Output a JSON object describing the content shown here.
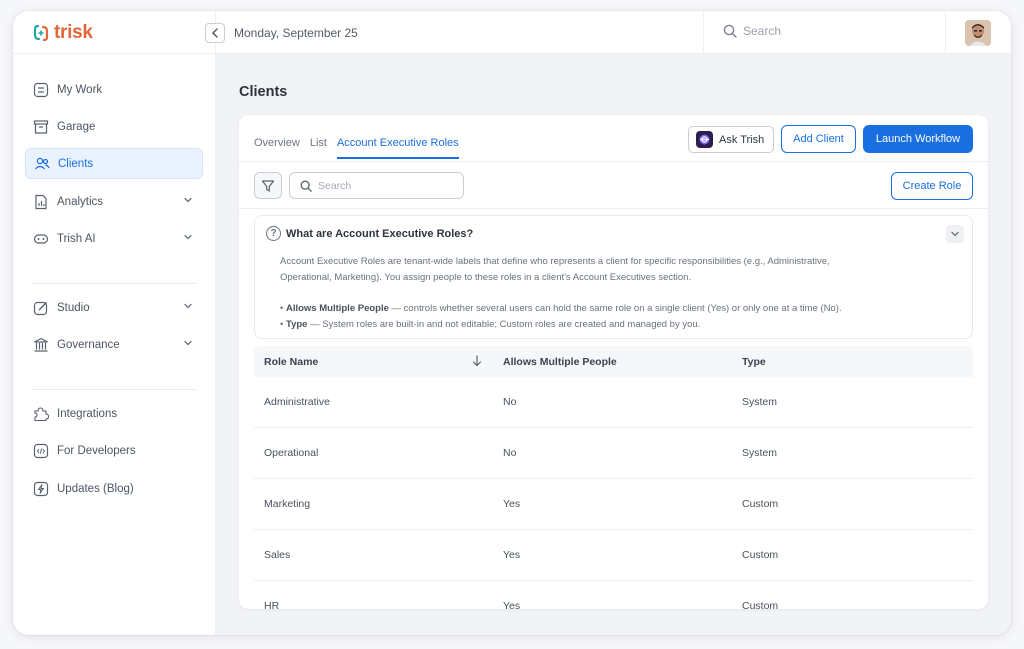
{
  "app": {
    "logo_text": "trisk",
    "brand_color": "#e2663a",
    "accent_color": "#1a6fe0"
  },
  "header": {
    "date": "Monday, September 25",
    "search_placeholder": "Search"
  },
  "sidebar": {
    "groups": [
      [
        {
          "label": "My Work",
          "icon": "my-work-icon"
        },
        {
          "label": "Garage",
          "icon": "garage-icon"
        },
        {
          "label": "Clients",
          "icon": "clients-icon",
          "active": true
        },
        {
          "label": "Analytics",
          "icon": "analytics-icon",
          "expandable": true
        },
        {
          "label": "Trish AI",
          "icon": "trish-ai-icon",
          "expandable": true
        }
      ],
      [
        {
          "label": "Studio",
          "icon": "studio-icon",
          "expandable": true
        },
        {
          "label": "Governance",
          "icon": "governance-icon",
          "expandable": true
        }
      ],
      [
        {
          "label": "Integrations",
          "icon": "integrations-icon"
        },
        {
          "label": "For Developers",
          "icon": "developers-icon"
        },
        {
          "label": "Updates (Blog)",
          "icon": "updates-icon"
        }
      ]
    ]
  },
  "main": {
    "title": "Clients",
    "tabs": [
      {
        "label": "Overview"
      },
      {
        "label": "List"
      },
      {
        "label": "Account Executive Roles",
        "active": true
      }
    ],
    "buttons": {
      "ask": "Ask Trish",
      "add": "Add Client",
      "launch": "Launch Workflow",
      "create_role": "Create Role"
    },
    "search_placeholder": "Search",
    "info": {
      "title": "What are Account Executive Roles?",
      "body": "Account Executive Roles are tenant-wide labels that define who represents a client for specific responsibilities (e.g., Administrative, Operational, Marketing). You assign people to these roles in a client's Account Executives section.",
      "bullets": [
        {
          "term": "Allows Multiple People",
          "text": " — controls whether several users can hold the same role on a single client (Yes) or only one at a time (No)."
        },
        {
          "term": "Type",
          "text": " — System roles are built-in and not editable; Custom roles are created and managed by you."
        }
      ]
    },
    "table": {
      "columns": [
        "Role Name",
        "Allows Multiple People",
        "Type"
      ],
      "rows": [
        [
          "Administrative",
          "No",
          "System"
        ],
        [
          "Operational",
          "No",
          "System"
        ],
        [
          "Marketing",
          "Yes",
          "Custom"
        ],
        [
          "Sales",
          "Yes",
          "Custom"
        ],
        [
          "HR",
          "Yes",
          "Custom"
        ]
      ]
    }
  }
}
